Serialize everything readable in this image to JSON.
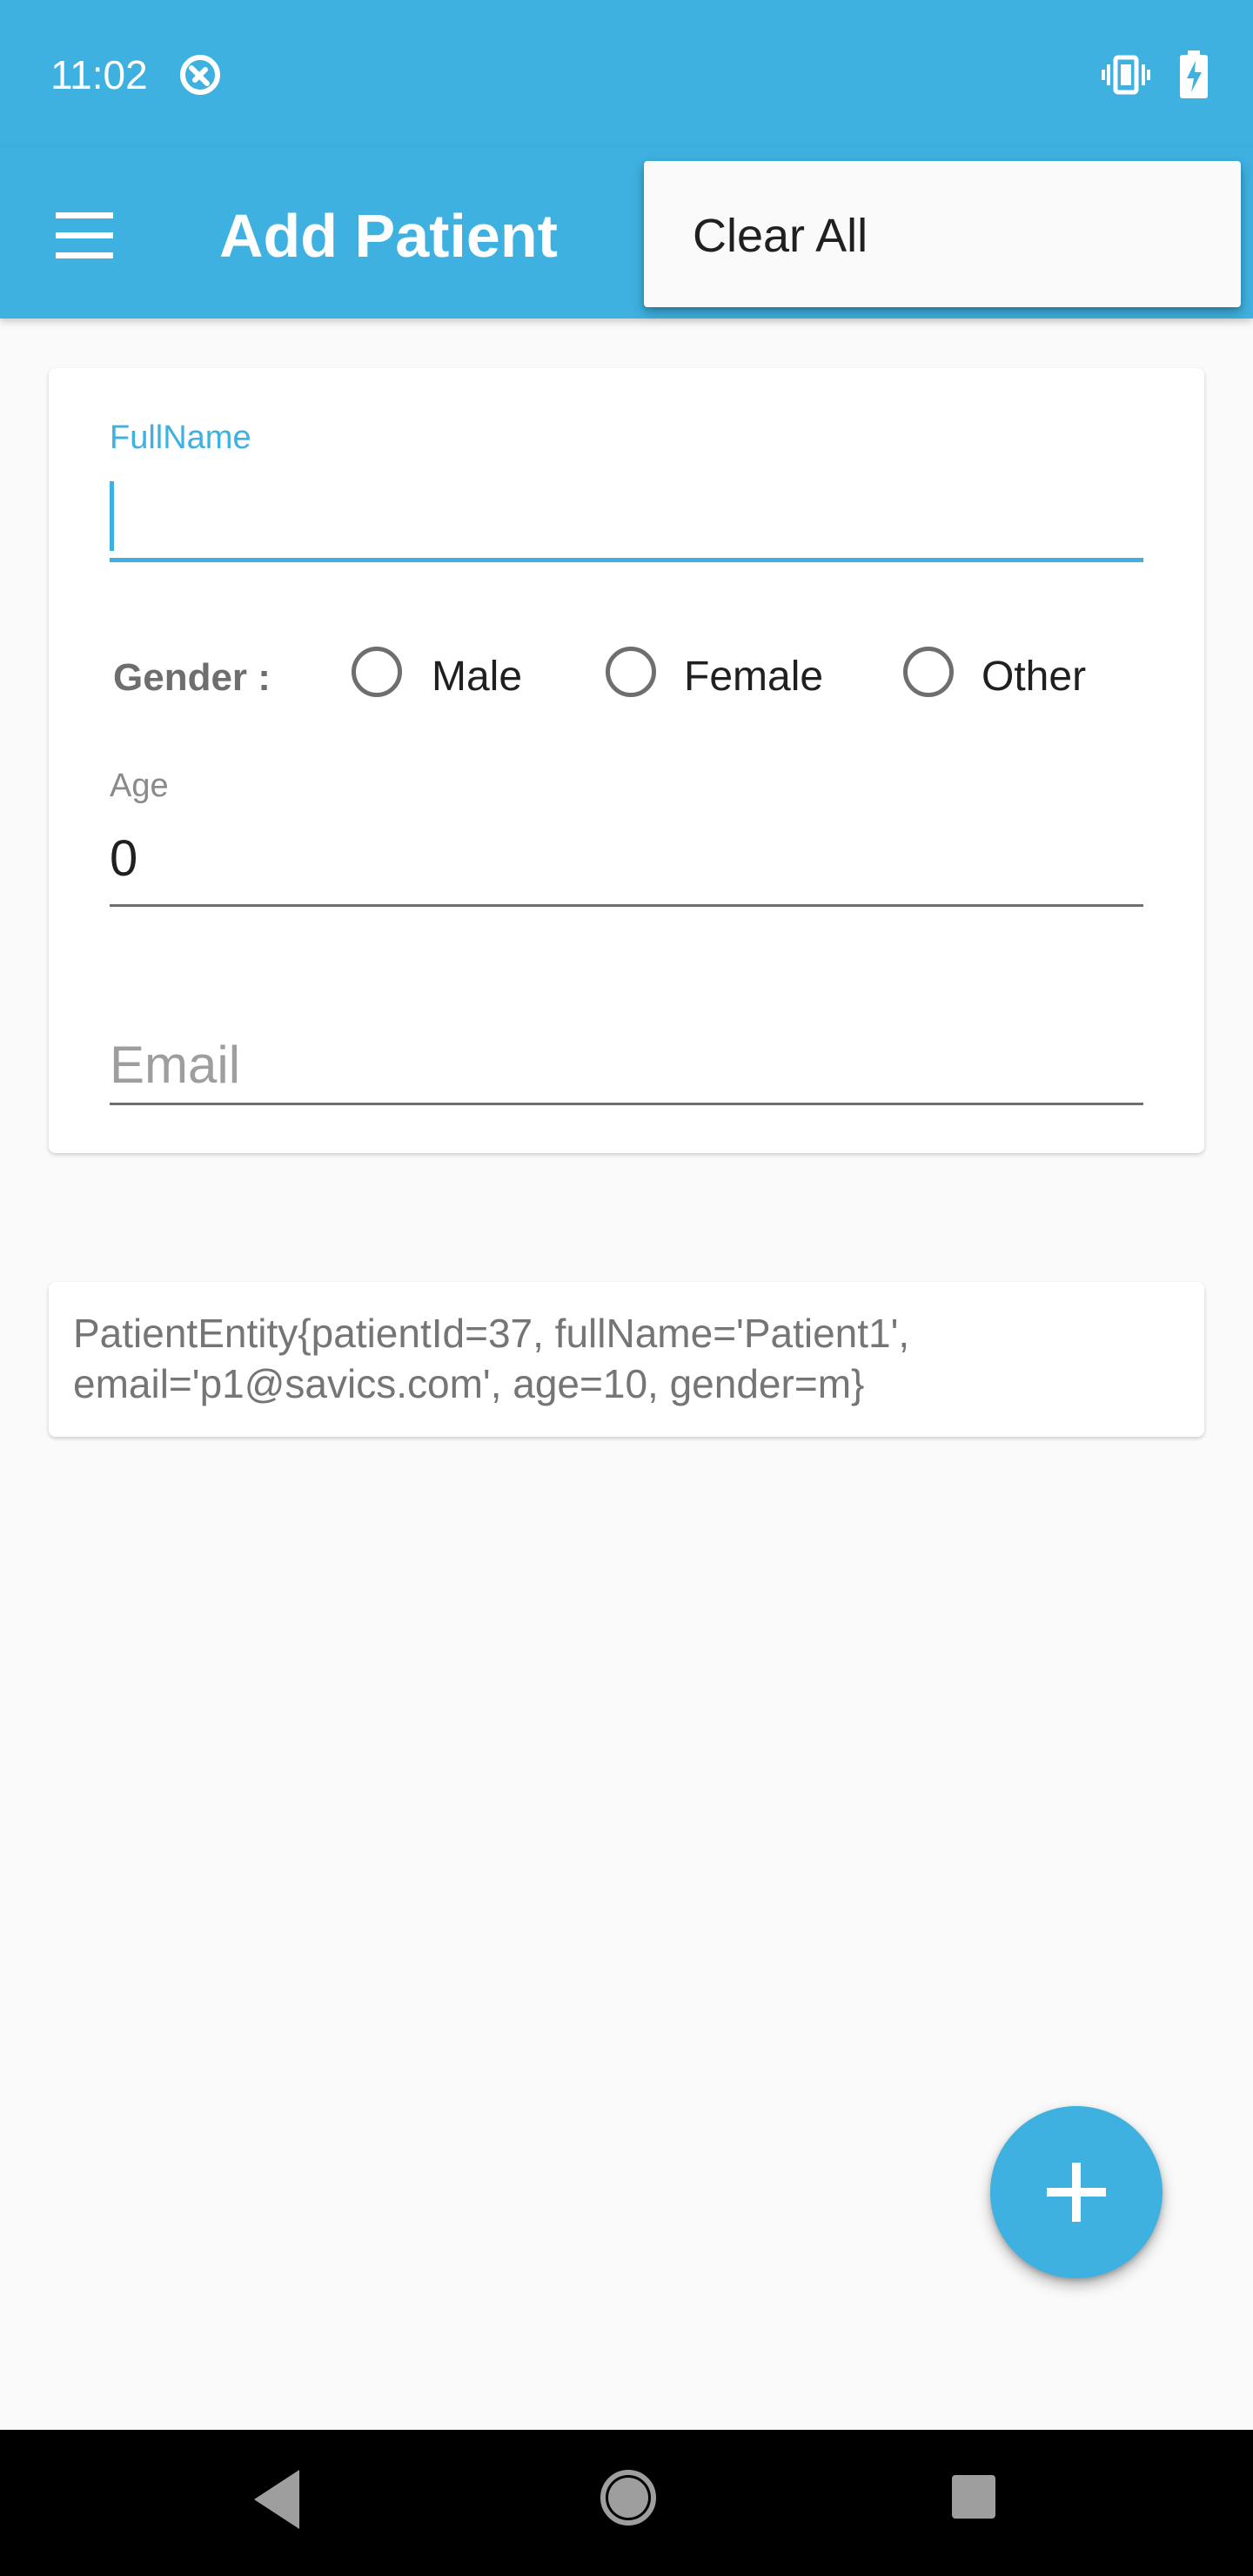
{
  "status_bar": {
    "time": "11:02",
    "icons": [
      "app-notification-icon",
      "vibrate-icon",
      "battery-charging-icon"
    ]
  },
  "app_bar": {
    "title": "Add Patient",
    "menu_icon": "hamburger-menu-icon"
  },
  "overflow_menu": {
    "items": [
      {
        "label": "Clear All"
      }
    ]
  },
  "form": {
    "fullname": {
      "label": "FullName",
      "value": ""
    },
    "gender": {
      "label": "Gender :",
      "options": [
        {
          "label": "Male",
          "selected": false
        },
        {
          "label": "Female",
          "selected": false
        },
        {
          "label": "Other",
          "selected": false
        }
      ]
    },
    "age": {
      "label": "Age",
      "value": "0"
    },
    "email": {
      "placeholder": "Email",
      "value": ""
    }
  },
  "entity_card": {
    "text": "PatientEntity{patientId=37, fullName='Patient1', email='p1@savics.com', age=10, gender=m}"
  },
  "fab": {
    "icon": "plus-icon"
  },
  "nav_bar": {
    "buttons": [
      "back-icon",
      "home-icon",
      "recents-icon"
    ]
  },
  "colors": {
    "primary": "#3EB1E0",
    "background": "#FAFAFA",
    "card": "#FFFFFF"
  }
}
